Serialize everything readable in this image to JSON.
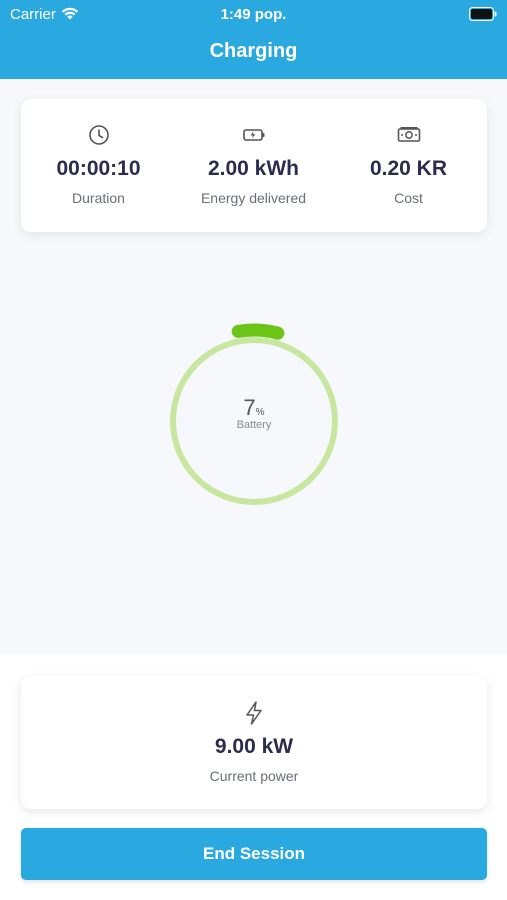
{
  "status_bar": {
    "carrier": "Carrier",
    "time": "1:49 pop.",
    "icons": [
      "wifi-icon",
      "battery-icon"
    ]
  },
  "header": {
    "title": "Charging"
  },
  "stats": [
    {
      "icon": "clock-icon",
      "value": "00:00:10",
      "label": "Duration"
    },
    {
      "icon": "battery-charging-icon",
      "value": "2.00 kWh",
      "label": "Energy delivered"
    },
    {
      "icon": "banknote-icon",
      "value": "0.20 KR",
      "label": "Cost"
    }
  ],
  "gauge": {
    "value": "7",
    "unit": "%",
    "label": "Battery",
    "level": 0.07,
    "track_color": "#c7e7a0",
    "fill_color": "#6cc417"
  },
  "power": {
    "icon": "lightning-icon",
    "value": "9.00 kW",
    "label": "Current power"
  },
  "actions": {
    "end_session": "End Session"
  },
  "colors": {
    "primary": "#2aa8e0",
    "text_dark": "#2a2d4e",
    "text_muted": "#6a6d7a"
  }
}
